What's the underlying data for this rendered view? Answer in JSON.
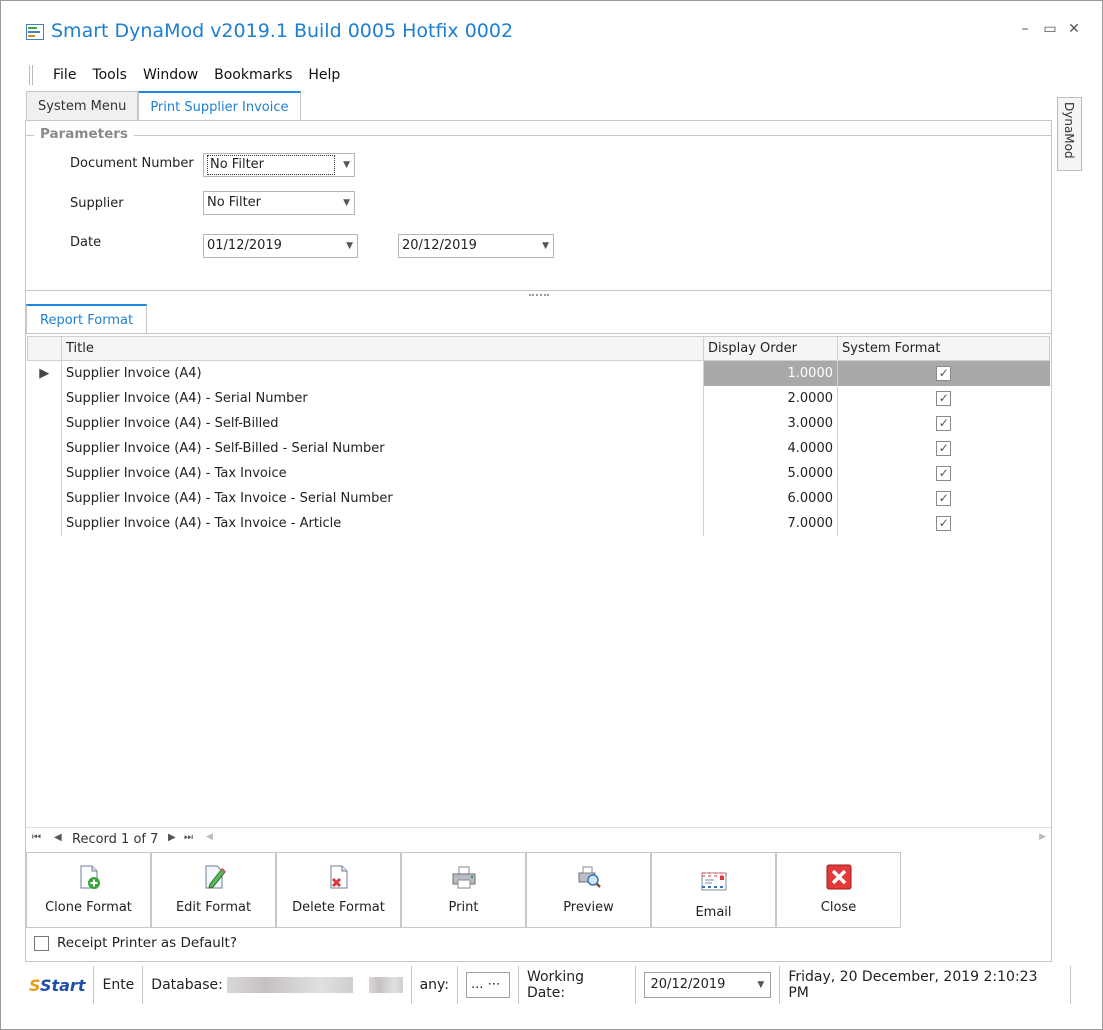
{
  "window": {
    "title": "Smart DynaMod v2019.1 Build 0005 Hotfix 0002",
    "controls": {
      "minimize": "–",
      "maximize": "▭",
      "close": "✕"
    }
  },
  "menu": [
    "File",
    "Tools",
    "Window",
    "Bookmarks",
    "Help"
  ],
  "tabs": [
    {
      "label": "System Menu",
      "active": false
    },
    {
      "label": "Print Supplier Invoice",
      "active": true
    }
  ],
  "side_tab": "DynaMod",
  "parameters": {
    "legend": "Parameters",
    "document_number": {
      "label": "Document Number",
      "value": "No Filter"
    },
    "supplier": {
      "label": "Supplier",
      "value": "No Filter"
    },
    "date": {
      "label": "Date",
      "from": "01/12/2019",
      "to": "20/12/2019"
    }
  },
  "report_format": {
    "tab_label": "Report Format",
    "columns": [
      "Title",
      "Display Order",
      "System Format"
    ],
    "rows": [
      {
        "title": "Supplier Invoice (A4)",
        "order": "1.0000",
        "system": true,
        "selected": true
      },
      {
        "title": "Supplier Invoice (A4) - Serial Number",
        "order": "2.0000",
        "system": true
      },
      {
        "title": "Supplier Invoice (A4) - Self-Billed",
        "order": "3.0000",
        "system": true
      },
      {
        "title": "Supplier Invoice (A4) - Self-Billed - Serial Number",
        "order": "4.0000",
        "system": true
      },
      {
        "title": "Supplier Invoice (A4) - Tax Invoice",
        "order": "5.0000",
        "system": true
      },
      {
        "title": "Supplier Invoice (A4) - Tax Invoice - Serial Number",
        "order": "6.0000",
        "system": true
      },
      {
        "title": "Supplier Invoice (A4) - Tax Invoice - Article",
        "order": "7.0000",
        "system": true
      }
    ],
    "navigator": "Record 1 of 7"
  },
  "toolbar": {
    "clone": "Clone Format",
    "edit": "Edit Format",
    "delete": "Delete Format",
    "print": "Print",
    "preview": "Preview",
    "email": "Email",
    "close": "Close"
  },
  "receipt_printer": "Receipt Printer as Default?",
  "status": {
    "logo_s": "S",
    "logo_text": "Start",
    "ente": "Ente",
    "database_label": "Database:",
    "company_label": "any:",
    "company_value": "... ⋯",
    "working_date_label": "Working Date:",
    "working_date_value": "20/12/2019",
    "datetime": "Friday, 20 December, 2019 2:10:23 PM"
  },
  "colors": {
    "accent": "#1e88e5",
    "title": "#1e7fd0",
    "selected_row": "#a9a9a9"
  }
}
